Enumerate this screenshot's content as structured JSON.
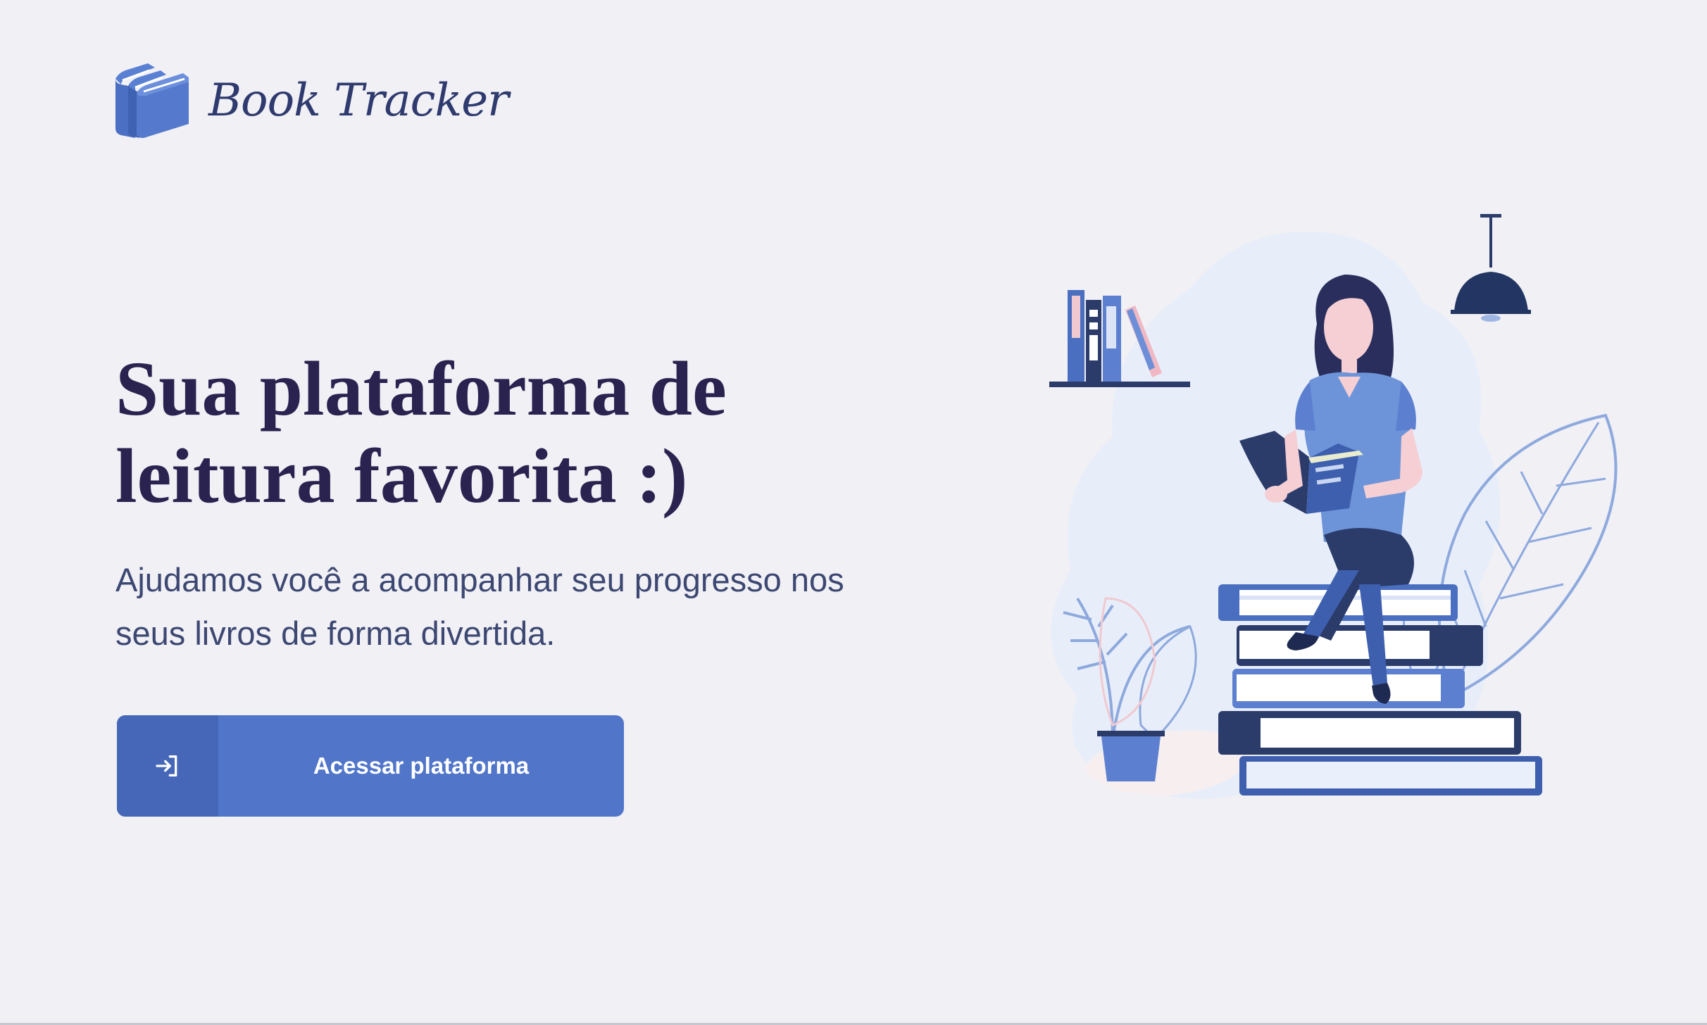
{
  "app": {
    "name": "Book Tracker",
    "logo_icon": "books-icon"
  },
  "hero": {
    "title_line1": "Sua plataforma de",
    "title_line2": "leitura favorita :)",
    "subtitle_line1": "Ajudamos você a acompanhar seu progresso nos",
    "subtitle_line2": "seus livros de forma divertida."
  },
  "cta": {
    "label": "Acessar plataforma",
    "icon": "sign-in-icon"
  },
  "illustration": {
    "subject": "woman-reading-on-books-illustration"
  },
  "colors": {
    "background": "#f0f0f5",
    "title": "#2a2350",
    "subtitle": "#3d4872",
    "accent": "#5075c9",
    "accent_dark": "#4667b8",
    "logo_text": "#2f3a6e"
  }
}
